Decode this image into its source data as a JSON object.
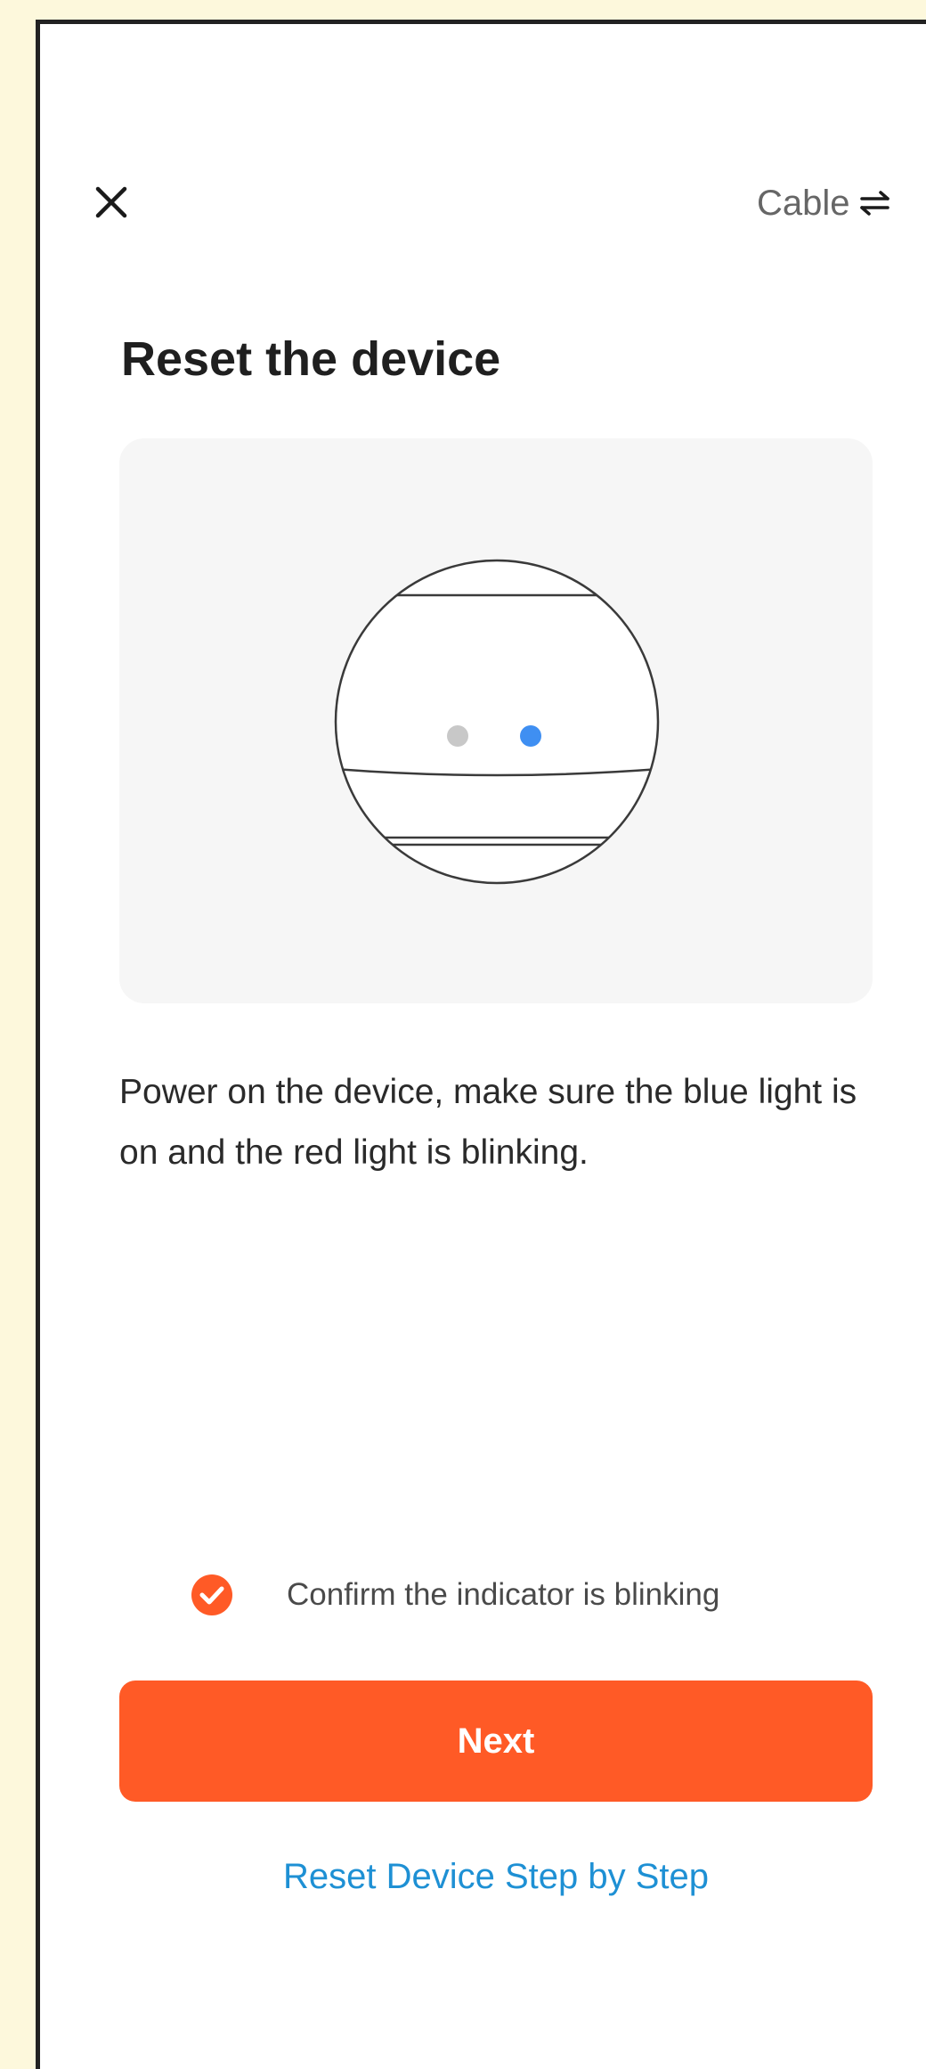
{
  "header": {
    "close_icon": "close-icon",
    "cable_label": "Cable",
    "cable_icon": "swap-arrows-icon"
  },
  "main": {
    "title": "Reset the device",
    "illustration": {
      "indicator_left_color": "#c8c8c8",
      "indicator_right_color": "#3f8ff2"
    },
    "instruction": "Power on the device, make sure the blue light is on and the red light is blinking."
  },
  "footer": {
    "confirm_checked": true,
    "confirm_label": "Confirm the indicator is blinking",
    "next_label": "Next",
    "reset_link_label": "Reset Device Step by Step"
  },
  "colors": {
    "accent": "#ff5a26",
    "link": "#1e90d4",
    "card_background": "#f6f6f6",
    "page_background": "#fdf8dc"
  }
}
